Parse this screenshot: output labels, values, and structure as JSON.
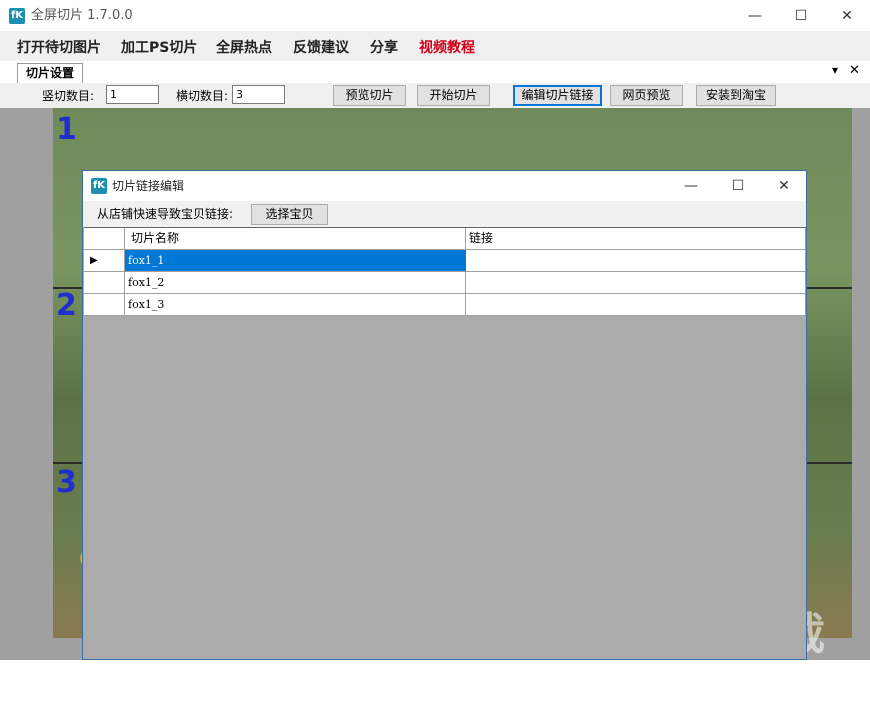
{
  "app": {
    "icon_text": "fK",
    "title": "全屏切片 1.7.0.0",
    "minimize": "—",
    "maximize": "☐",
    "close": "✕"
  },
  "menu": [
    "打开待切图片",
    "加工PS切片",
    "全屏热点",
    "反馈建议",
    "分享",
    "视频教程"
  ],
  "menu_highlight_color": "#d0021b",
  "tabs": {
    "active": "切片设置",
    "dropdown": "▾",
    "close": "✕"
  },
  "toolbar": {
    "vertical_label": "竖切数目:",
    "vertical_value": "1",
    "horizontal_label": "横切数目:",
    "horizontal_value": "3",
    "buttons": [
      "预览切片",
      "开始切片",
      "编辑切片链接",
      "网页预览",
      "安装到淘宝"
    ]
  },
  "slices": [
    "1",
    "2",
    "3"
  ],
  "dialog": {
    "icon_text": "fK",
    "title": "切片链接编辑",
    "minimize": "—",
    "maximize": "☐",
    "close": "✕",
    "import_label": "从店铺快速导致宝贝链接:",
    "select_button": "选择宝贝",
    "columns": [
      "切片名称",
      "链接"
    ],
    "rows": [
      {
        "name": "fox1_1",
        "link": "",
        "selected": true
      },
      {
        "name": "fox1_2",
        "link": "",
        "selected": false
      },
      {
        "name": "fox1_3",
        "link": "",
        "selected": false
      }
    ],
    "row_indicator": "▶"
  },
  "watermark": "下载吧"
}
